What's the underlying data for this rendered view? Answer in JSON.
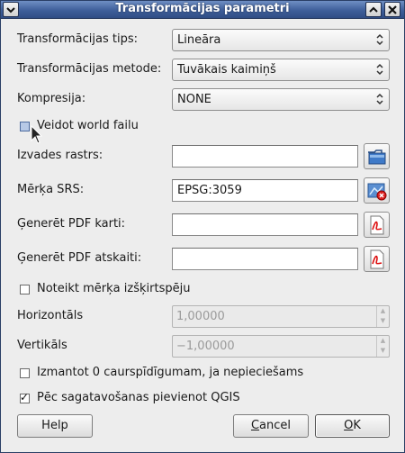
{
  "titlebar": {
    "title": "Transformācijas parametri",
    "menu_icon": "chevron-down-icon",
    "shade_icon": "chevron-up-icon",
    "close_icon": "close-icon"
  },
  "transform_type": {
    "label": "Transformācijas tips:",
    "value": "Lineāra"
  },
  "transform_method": {
    "label": "Transformācijas metode:",
    "value": "Tuvākais kaimiņš"
  },
  "compression": {
    "label": "Kompresija:",
    "value": "NONE"
  },
  "world_file": {
    "label": "Veidot world failu",
    "checked": false
  },
  "output_raster": {
    "label": "Izvades rastrs:",
    "value": "",
    "button_icon": "folder-open-icon"
  },
  "target_srs": {
    "label": "Mērķa SRS:",
    "value": "EPSG:3059",
    "button_icon": "projection-icon"
  },
  "pdf_map": {
    "label": "Ģenerēt PDF karti:",
    "value": "",
    "button_icon": "pdf-icon"
  },
  "pdf_report": {
    "label": "Ģenerēt PDF atskaiti:",
    "value": "",
    "button_icon": "pdf-icon"
  },
  "target_resolution": {
    "label": "Noteikt mērķa izšķirtspēju",
    "checked": false
  },
  "horizontal": {
    "label": "Horizontāls",
    "value": "1,00000"
  },
  "vertical": {
    "label": "Vertikāls",
    "value": "−1,00000"
  },
  "use_zero_transparency": {
    "label": "Izmantot 0 caurspīdīgumam, ja nepieciešams",
    "checked": false
  },
  "load_in_qgis": {
    "label": "Pēc sagatavošanas pievienot QGIS",
    "checked": true
  },
  "buttons": {
    "help": "Help",
    "cancel_mnemonic": "C",
    "cancel_rest": "ancel",
    "ok_mnemonic": "O",
    "ok_rest": "K"
  }
}
